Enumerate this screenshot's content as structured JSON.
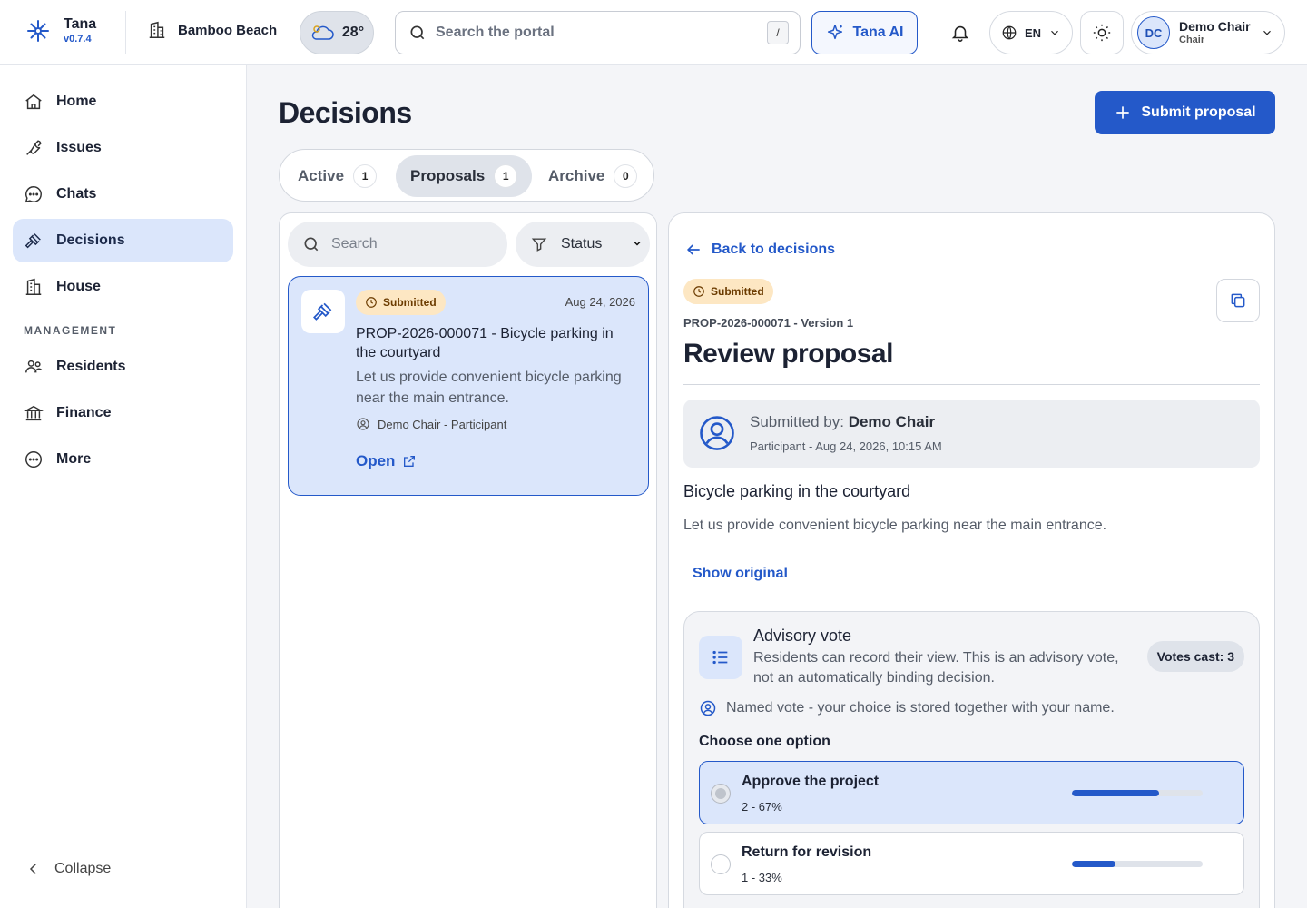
{
  "brand": {
    "name": "Tana",
    "version": "v0.7.4"
  },
  "header": {
    "building": "Bamboo Beach",
    "temperature": "28°",
    "search_placeholder": "Search the portal",
    "search_shortcut": "/",
    "ai_label": "Tana AI",
    "language": "EN",
    "user": {
      "initials": "DC",
      "name": "Demo Chair",
      "role": "Chair"
    }
  },
  "sidebar": {
    "items": [
      {
        "label": "Home",
        "icon": "home-icon"
      },
      {
        "label": "Issues",
        "icon": "wrench-icon"
      },
      {
        "label": "Chats",
        "icon": "chat-icon"
      },
      {
        "label": "Decisions",
        "icon": "gavel-icon",
        "active": true
      },
      {
        "label": "House",
        "icon": "building-icon"
      }
    ],
    "section_label": "MANAGEMENT",
    "management_items": [
      {
        "label": "Residents",
        "icon": "people-icon"
      },
      {
        "label": "Finance",
        "icon": "bank-icon"
      },
      {
        "label": "More",
        "icon": "more-icon"
      }
    ],
    "collapse_label": "Collapse"
  },
  "page": {
    "title": "Decisions",
    "submit_label": "Submit proposal",
    "tabs": [
      {
        "label": "Active",
        "count": "1"
      },
      {
        "label": "Proposals",
        "count": "1",
        "active": true
      },
      {
        "label": "Archive",
        "count": "0"
      }
    ]
  },
  "list": {
    "search_placeholder": "Search",
    "status_filter": "Status",
    "cards": [
      {
        "status": "Submitted",
        "date": "Aug 24, 2026",
        "title": "PROP-2026-000071 - Bicycle parking in the courtyard",
        "description": "Let us provide convenient bicycle parking near the main entrance.",
        "author": "Demo Chair - Participant",
        "open_label": "Open"
      }
    ]
  },
  "detail": {
    "back_label": "Back to decisions",
    "status": "Submitted",
    "reference": "PROP-2026-000071 - Version 1",
    "title": "Review proposal",
    "submitted_by_label": "Submitted by:",
    "submitted_by_name": "Demo Chair",
    "submitted_meta": "Participant - Aug 24, 2026, 10:15 AM",
    "proposal_title": "Bicycle parking in the courtyard",
    "proposal_description": "Let us provide convenient bicycle parking near the main entrance.",
    "show_original": "Show original",
    "vote": {
      "title": "Advisory vote",
      "subtitle": "Residents can record their view. This is an advisory vote, not an automatically binding decision.",
      "votes_cast": "Votes cast: 3",
      "named_notice": "Named vote - your choice is stored together with your name.",
      "choose_label": "Choose one option",
      "options": [
        {
          "label": "Approve the project",
          "stat": "2 - 67%",
          "share": 0.67,
          "selected": true
        },
        {
          "label": "Return for revision",
          "stat": "1 - 33%",
          "share": 0.33,
          "selected": false
        }
      ]
    }
  },
  "colors": {
    "accent": "#2459c9",
    "accent_soft": "#dbe6fb",
    "badge_bg": "#fde7c3",
    "badge_text": "#6b3b00"
  }
}
